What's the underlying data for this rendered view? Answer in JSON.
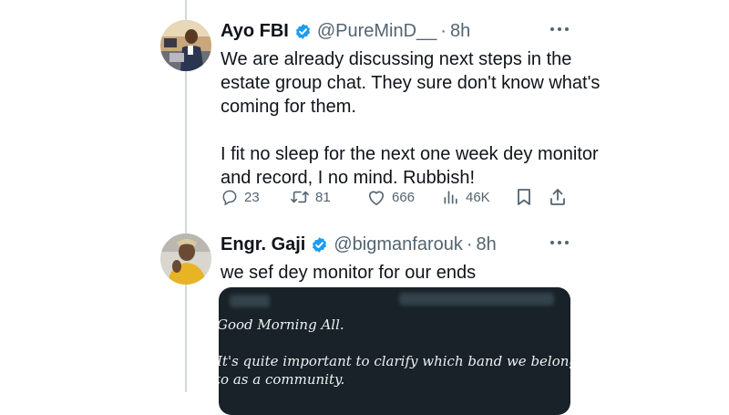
{
  "tweets": [
    {
      "author_name": "Ayo FBI",
      "handle": "@PureMinD__",
      "separator": "·",
      "time": "8h",
      "text_paragraphs": [
        "We are already discussing next steps in the estate group chat. They sure don't know what's coming for them.",
        "I fit no sleep for the next one week dey monitor and record, I no mind. Rubbish!"
      ],
      "actions": {
        "replies": "23",
        "retweets": "81",
        "likes": "666",
        "views": "46K"
      }
    },
    {
      "author_name": "Engr. Gaji",
      "handle": "@bigmanfarouk",
      "separator": "·",
      "time": "8h",
      "text": "we sef dey monitor for our ends",
      "attached_image_text": {
        "line1": "Good Morning All.",
        "line2": "It's quite important to clarify which band we belong",
        "line3": "to as a community."
      }
    }
  ],
  "icons": {
    "verified": "verified-badge-icon",
    "more": "more-options-icon",
    "reply": "reply-icon",
    "retweet": "retweet-icon",
    "like": "heart-icon",
    "views": "views-chart-icon",
    "bookmark": "bookmark-icon",
    "share": "share-icon"
  },
  "colors": {
    "verified_blue": "#1d9bf0",
    "secondary_text": "#536471",
    "primary_text": "#0f1419",
    "thread_line": "#cfd9de"
  }
}
